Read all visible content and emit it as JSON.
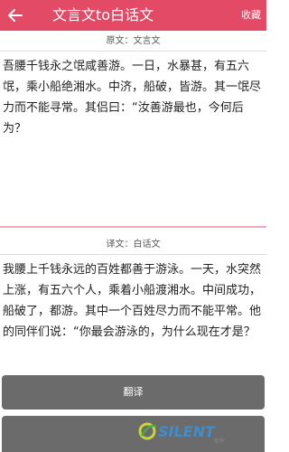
{
  "header": {
    "title": "文言文to白话文",
    "favorite_label": "收藏"
  },
  "original": {
    "label": "原文：文言文",
    "text": "吾腰千钱永之氓咸善游。一日，水暴甚，有五六氓，乘小船绝湘水。中济，船破，皆游。其一氓尽力而不能寻常。其侣曰：“汝善游最也，今何后为？"
  },
  "translation": {
    "label": "译文：白话文",
    "text": "我腰上千钱永远的百姓都善于游泳。一天，水突然上涨，有五六个人，乘着小船渡湘水。中间成功，船破了，都游。其中一个百姓尽力而不能平常。他的同伴们说：“你最会游泳的，为什么现在才是？"
  },
  "actions": {
    "translate_label": "翻译"
  },
  "watermark": {
    "brand": "SILENT",
    "sub": "软件"
  },
  "colors": {
    "accent": "#e24a66",
    "button": "#6b6b6b"
  }
}
